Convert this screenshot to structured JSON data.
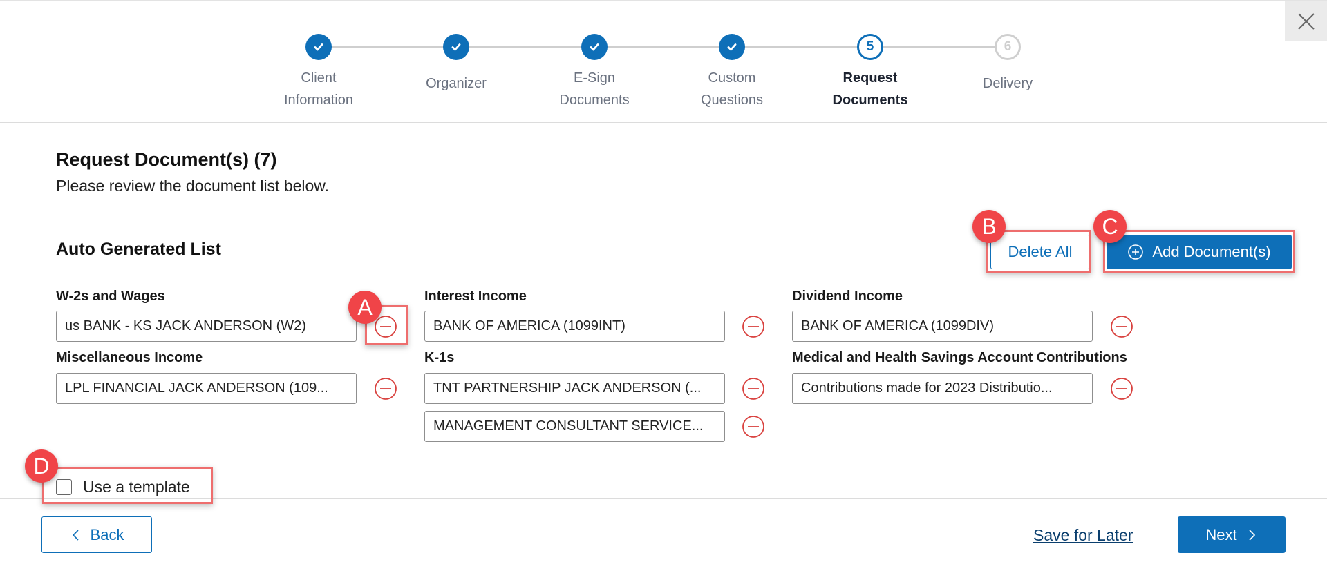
{
  "header": {
    "close_label": "Close",
    "steps": [
      {
        "number": "1",
        "label": "Client Information",
        "line1": "Client",
        "line2": "Information",
        "status": "done"
      },
      {
        "number": "2",
        "label": "Organizer",
        "line1": "Organizer",
        "line2": "",
        "status": "done"
      },
      {
        "number": "3",
        "label": "E-Sign Documents",
        "line1": "E-Sign",
        "line2": "Documents",
        "status": "done"
      },
      {
        "number": "4",
        "label": "Custom Questions",
        "line1": "Custom",
        "line2": "Questions",
        "status": "done"
      },
      {
        "number": "5",
        "label": "Request Documents",
        "line1": "Request",
        "line2": "Documents",
        "status": "current"
      },
      {
        "number": "6",
        "label": "Delivery",
        "line1": "Delivery",
        "line2": "",
        "status": "pending"
      }
    ]
  },
  "main": {
    "title": "Request Document(s) (7)",
    "subtitle": "Please review the document list below.",
    "list_title": "Auto Generated List",
    "delete_all_label": "Delete All",
    "add_document_label": "Add Document(s)",
    "categories": [
      {
        "label": "W-2s and Wages",
        "items": [
          "us BANK - KS JACK ANDERSON (W2)"
        ]
      },
      {
        "label": "Interest Income",
        "items": [
          "BANK OF AMERICA (1099INT)"
        ]
      },
      {
        "label": "Dividend Income",
        "items": [
          "BANK OF AMERICA (1099DIV)"
        ]
      },
      {
        "label": "Miscellaneous Income",
        "items": [
          "LPL FINANCIAL JACK ANDERSON (109..."
        ]
      },
      {
        "label": "K-1s",
        "items": [
          "TNT PARTNERSHIP JACK ANDERSON (...",
          "MANAGEMENT CONSULTANT SERVICE..."
        ]
      },
      {
        "label": "Medical and Health Savings Account Contributions",
        "items": [
          "Contributions made for 2023 Distributio..."
        ]
      }
    ],
    "use_template_label": "Use a template",
    "use_template_checked": false
  },
  "footer": {
    "back_label": "Back",
    "save_later_label": "Save for Later",
    "next_label": "Next"
  },
  "annotations": {
    "a": "A",
    "b": "B",
    "c": "C",
    "d": "D"
  },
  "colors": {
    "primary": "#0e6fb8",
    "danger": "#d9423f",
    "annotation": "#f04448"
  }
}
